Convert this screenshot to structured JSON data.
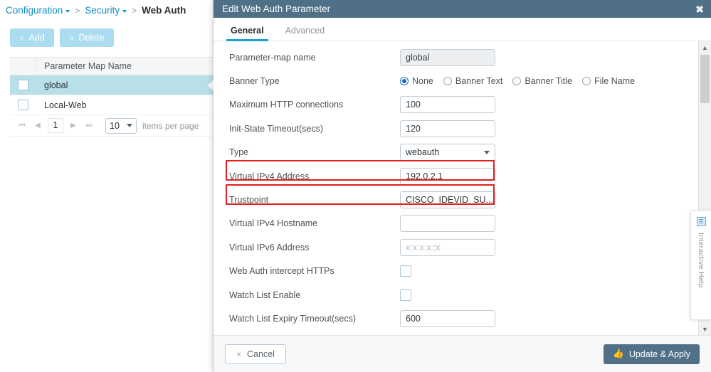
{
  "breadcrumb": {
    "items": [
      {
        "label": "Configuration",
        "caret": true
      },
      {
        "label": "Security",
        "caret": true
      }
    ],
    "separator": ">",
    "current": "Web Auth"
  },
  "toolbar": {
    "add_label": "Add",
    "add_glyph": "+",
    "delete_label": "Delete",
    "delete_glyph": "×"
  },
  "table": {
    "header": "Parameter Map Name",
    "rows": [
      {
        "name": "global",
        "selected": true
      },
      {
        "name": "Local-Web",
        "selected": false
      }
    ]
  },
  "pager": {
    "first_glyph": "⏮",
    "prev_glyph": "◀",
    "page": "1",
    "next_glyph": "▶",
    "last_glyph": "⏭",
    "page_size": "10",
    "items_per_page_label": "items per page"
  },
  "dialog": {
    "title": "Edit Web Auth Parameter",
    "close_glyph": "✖",
    "tabs": [
      {
        "label": "General",
        "active": true
      },
      {
        "label": "Advanced",
        "active": false
      }
    ],
    "fields": {
      "param_map_name": {
        "label": "Parameter-map name",
        "value": "global"
      },
      "banner_type": {
        "label": "Banner Type",
        "options": [
          {
            "label": "None",
            "checked": true
          },
          {
            "label": "Banner Text",
            "checked": false
          },
          {
            "label": "Banner Title",
            "checked": false
          },
          {
            "label": "File Name",
            "checked": false
          }
        ]
      },
      "max_http": {
        "label": "Maximum HTTP connections",
        "value": "100"
      },
      "init_state_timeout": {
        "label": "Init-State Timeout(secs)",
        "value": "120"
      },
      "type": {
        "label": "Type",
        "value": "webauth"
      },
      "virtual_ipv4_address": {
        "label": "Virtual IPv4 Address",
        "value": "192.0.2.1",
        "highlighted": true
      },
      "trustpoint": {
        "label": "Trustpoint",
        "value": "CISCO_IDEVID_SU...",
        "highlighted": true
      },
      "virtual_ipv4_hostname": {
        "label": "Virtual IPv4 Hostname",
        "value": ""
      },
      "virtual_ipv6_address": {
        "label": "Virtual IPv6 Address",
        "value": "",
        "placeholder": "x:x:x:x::x"
      },
      "intercept_https": {
        "label": "Web Auth intercept HTTPs",
        "checked": false
      },
      "watch_list_enable": {
        "label": "Watch List Enable",
        "checked": false
      },
      "watch_list_expiry": {
        "label": "Watch List Expiry Timeout(secs)",
        "value": "600"
      }
    },
    "footer": {
      "cancel_label": "Cancel",
      "cancel_glyph": "×",
      "apply_label": "Update & Apply",
      "apply_glyph": "👍"
    },
    "scrollbar": {
      "up_glyph": "▲",
      "down_glyph": "▼"
    }
  },
  "help_tab": {
    "label": "Interactive Help",
    "icon_glyph": "☰"
  },
  "colors": {
    "header_bg": "#4f7087",
    "accent": "#1ba0d7",
    "highlight": "#e02020",
    "selected_row": "#b9dfe9"
  }
}
